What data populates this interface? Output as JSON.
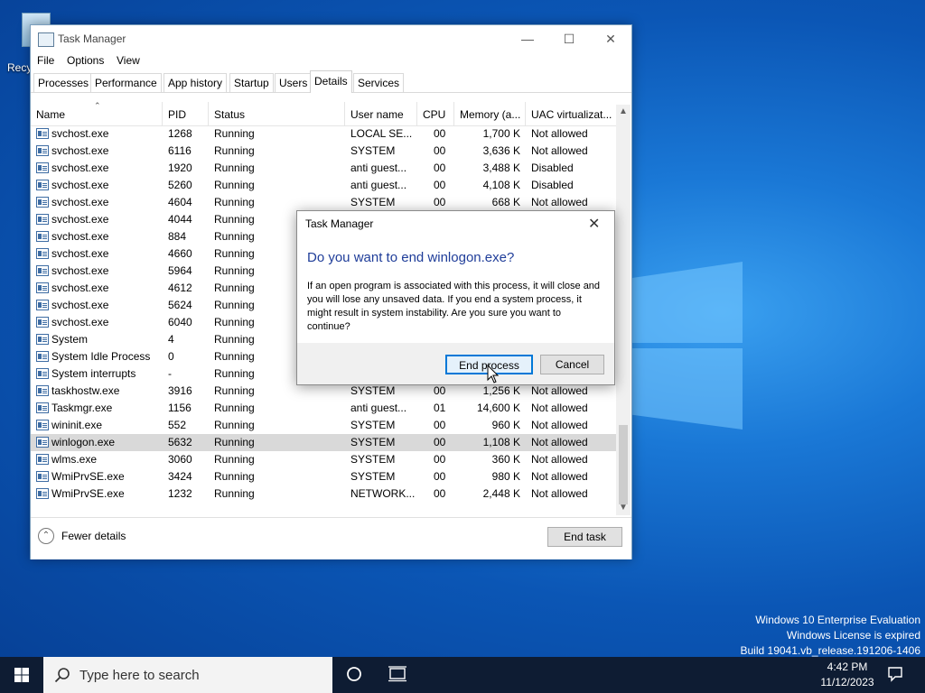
{
  "desktop": {
    "recycle_bin_label": "Recy",
    "watermark": [
      "Windows 10 Enterprise Evaluation",
      "Windows License is expired",
      "Build 19041.vb_release.191206-1406"
    ]
  },
  "window": {
    "title": "Task Manager",
    "menu": [
      "File",
      "Options",
      "View"
    ],
    "tabs": [
      "Processes",
      "Performance",
      "App history",
      "Startup",
      "Users",
      "Details",
      "Services"
    ],
    "active_tab": "Details",
    "columns": [
      "Name",
      "PID",
      "Status",
      "User name",
      "CPU",
      "Memory (a...",
      "UAC virtualizat..."
    ],
    "rows": [
      {
        "name": "svchost.exe",
        "pid": "1268",
        "status": "Running",
        "user": "LOCAL SE...",
        "cpu": "00",
        "mem": "1,700 K",
        "uac": "Not allowed"
      },
      {
        "name": "svchost.exe",
        "pid": "6116",
        "status": "Running",
        "user": "SYSTEM",
        "cpu": "00",
        "mem": "3,636 K",
        "uac": "Not allowed"
      },
      {
        "name": "svchost.exe",
        "pid": "1920",
        "status": "Running",
        "user": "anti guest...",
        "cpu": "00",
        "mem": "3,488 K",
        "uac": "Disabled"
      },
      {
        "name": "svchost.exe",
        "pid": "5260",
        "status": "Running",
        "user": "anti guest...",
        "cpu": "00",
        "mem": "4,108 K",
        "uac": "Disabled"
      },
      {
        "name": "svchost.exe",
        "pid": "4604",
        "status": "Running",
        "user": "SYSTEM",
        "cpu": "00",
        "mem": "668 K",
        "uac": "Not allowed"
      },
      {
        "name": "svchost.exe",
        "pid": "4044",
        "status": "Running",
        "user": "",
        "cpu": "",
        "mem": "",
        "uac": ""
      },
      {
        "name": "svchost.exe",
        "pid": "884",
        "status": "Running",
        "user": "",
        "cpu": "",
        "mem": "",
        "uac": ""
      },
      {
        "name": "svchost.exe",
        "pid": "4660",
        "status": "Running",
        "user": "",
        "cpu": "",
        "mem": "",
        "uac": ""
      },
      {
        "name": "svchost.exe",
        "pid": "5964",
        "status": "Running",
        "user": "",
        "cpu": "",
        "mem": "",
        "uac": ""
      },
      {
        "name": "svchost.exe",
        "pid": "4612",
        "status": "Running",
        "user": "",
        "cpu": "",
        "mem": "",
        "uac": ""
      },
      {
        "name": "svchost.exe",
        "pid": "5624",
        "status": "Running",
        "user": "",
        "cpu": "",
        "mem": "",
        "uac": ""
      },
      {
        "name": "svchost.exe",
        "pid": "6040",
        "status": "Running",
        "user": "",
        "cpu": "",
        "mem": "",
        "uac": ""
      },
      {
        "name": "System",
        "pid": "4",
        "status": "Running",
        "user": "",
        "cpu": "",
        "mem": "",
        "uac": ""
      },
      {
        "name": "System Idle Process",
        "pid": "0",
        "status": "Running",
        "user": "",
        "cpu": "",
        "mem": "",
        "uac": ""
      },
      {
        "name": "System interrupts",
        "pid": "-",
        "status": "Running",
        "user": "",
        "cpu": "",
        "mem": "",
        "uac": ""
      },
      {
        "name": "taskhostw.exe",
        "pid": "3916",
        "status": "Running",
        "user": "SYSTEM",
        "cpu": "00",
        "mem": "1,256 K",
        "uac": "Not allowed"
      },
      {
        "name": "Taskmgr.exe",
        "pid": "1156",
        "status": "Running",
        "user": "anti guest...",
        "cpu": "01",
        "mem": "14,600 K",
        "uac": "Not allowed"
      },
      {
        "name": "wininit.exe",
        "pid": "552",
        "status": "Running",
        "user": "SYSTEM",
        "cpu": "00",
        "mem": "960 K",
        "uac": "Not allowed"
      },
      {
        "name": "winlogon.exe",
        "pid": "5632",
        "status": "Running",
        "user": "SYSTEM",
        "cpu": "00",
        "mem": "1,108 K",
        "uac": "Not allowed",
        "selected": true
      },
      {
        "name": "wlms.exe",
        "pid": "3060",
        "status": "Running",
        "user": "SYSTEM",
        "cpu": "00",
        "mem": "360 K",
        "uac": "Not allowed"
      },
      {
        "name": "WmiPrvSE.exe",
        "pid": "3424",
        "status": "Running",
        "user": "SYSTEM",
        "cpu": "00",
        "mem": "980 K",
        "uac": "Not allowed"
      },
      {
        "name": "WmiPrvSE.exe",
        "pid": "1232",
        "status": "Running",
        "user": "NETWORK...",
        "cpu": "00",
        "mem": "2,448 K",
        "uac": "Not allowed"
      }
    ],
    "fewer_details_label": "Fewer details",
    "end_task_label": "End task"
  },
  "dialog": {
    "title": "Task Manager",
    "heading": "Do you want to end winlogon.exe?",
    "body": "If an open program is associated with this process, it will close and you will lose any unsaved data. If you end a system process, it might result in system instability. Are you sure you want to continue?",
    "end_process_label": "End process",
    "cancel_label": "Cancel"
  },
  "taskbar": {
    "search_placeholder": "Type here to search",
    "time": "4:42 PM",
    "date": "11/12/2023"
  },
  "colors": {
    "accent": "#1f3d99",
    "selection": "#d9d9d9",
    "taskbar": "#0e1c33"
  }
}
